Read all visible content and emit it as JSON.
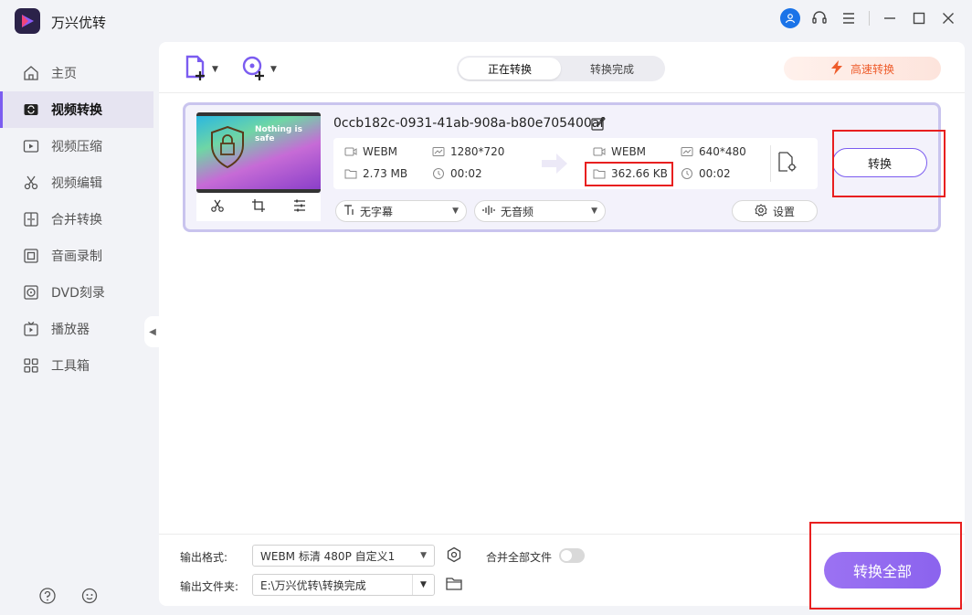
{
  "app": {
    "title": "万兴优转"
  },
  "sidebar": {
    "items": [
      {
        "label": "主页",
        "icon": "home-icon"
      },
      {
        "label": "视频转换",
        "icon": "video-convert-icon",
        "active": true
      },
      {
        "label": "视频压缩",
        "icon": "video-compress-icon"
      },
      {
        "label": "视频编辑",
        "icon": "scissors-icon"
      },
      {
        "label": "合并转换",
        "icon": "merge-icon"
      },
      {
        "label": "音画录制",
        "icon": "record-icon"
      },
      {
        "label": "DVD刻录",
        "icon": "dvd-icon"
      },
      {
        "label": "播放器",
        "icon": "player-icon"
      },
      {
        "label": "工具箱",
        "icon": "toolbox-icon"
      }
    ]
  },
  "tabs": {
    "converting": "正在转换",
    "completed": "转换完成"
  },
  "turbo": {
    "label": "高速转换"
  },
  "task": {
    "filename": "0ccb182c-0931-41ab-908a-b80e705400af",
    "thumb_text": "Nothing is safe",
    "source": {
      "format": "WEBM",
      "resolution": "1280*720",
      "size": "2.73 MB",
      "duration": "00:02"
    },
    "target": {
      "format": "WEBM",
      "resolution": "640*480",
      "size": "362.66 KB",
      "duration": "00:02"
    },
    "subtitle": "无字幕",
    "audio": "无音频",
    "settings_label": "设置",
    "convert_label": "转换"
  },
  "bottom": {
    "format_label": "输出格式:",
    "format_value": "WEBM 标清 480P 自定义1",
    "folder_label": "输出文件夹:",
    "folder_value": "E:\\万兴优转\\转换完成",
    "merge_label": "合并全部文件",
    "convert_all_label": "转换全部"
  },
  "colors": {
    "accent": "#7b5cf0",
    "highlight": "#e81f1f",
    "turbo": "#ee5c2b"
  }
}
